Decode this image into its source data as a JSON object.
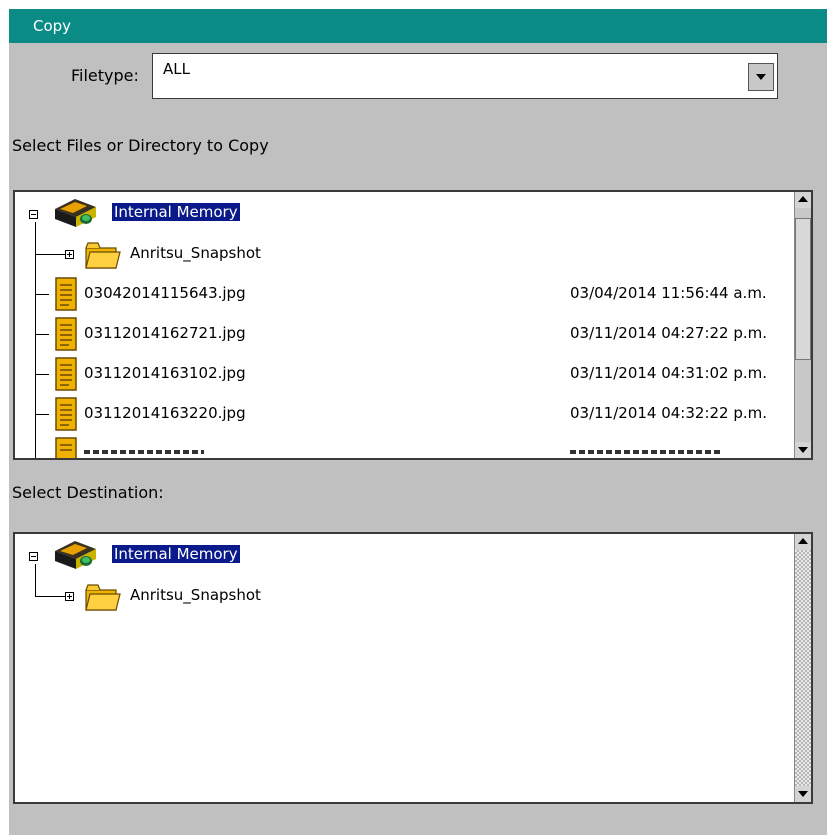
{
  "dialog": {
    "title": "Copy"
  },
  "filetype": {
    "label": "Filetype:",
    "selected": "ALL"
  },
  "source": {
    "heading": "Select Files or Directory to Copy",
    "root": "Internal Memory",
    "folder": "Anritsu_Snapshot",
    "files": [
      {
        "name": "03042014115643.jpg",
        "date": "03/04/2014 11:56:44 a.m."
      },
      {
        "name": "03112014162721.jpg",
        "date": "03/11/2014 04:27:22 p.m."
      },
      {
        "name": "03112014163102.jpg",
        "date": "03/11/2014 04:31:02 p.m."
      },
      {
        "name": "03112014163220.jpg",
        "date": "03/11/2014 04:32:22 p.m."
      }
    ]
  },
  "destination": {
    "heading": "Select Destination:",
    "root": "Internal Memory",
    "folder": "Anritsu_Snapshot"
  },
  "icons": {
    "drive": "memory-drive-icon",
    "folder": "folder-icon",
    "file": "document-file-icon"
  }
}
